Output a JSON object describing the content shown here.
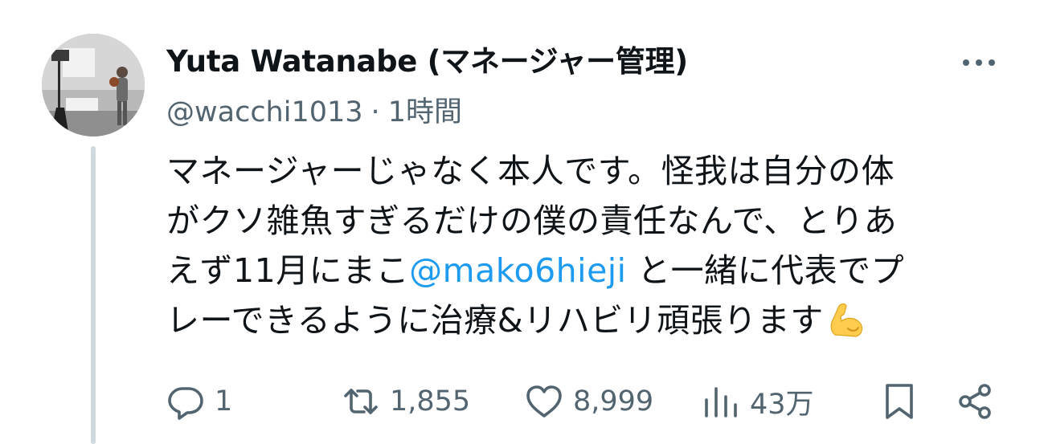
{
  "author": {
    "display_name": "Yuta Watanabe (マネージャー管理)",
    "handle": "@wacchi1013",
    "separator": "·",
    "timestamp": "1時間"
  },
  "tweet": {
    "line1": "マネージャーじゃなく本人です。怪我は自分の体",
    "line2": "がクソ雑魚すぎるだけの僕の責任なんで、とりあ",
    "line3_before": "えず11月にまこ",
    "line3_mention": "@mako6hieji",
    "line3_after": " と一緒に代表でプ",
    "line4": "レーできるように治療&リハビリ頑張ります",
    "emoji": "flexed-biceps-emoji"
  },
  "metrics": {
    "replies": "1",
    "retweets": "1,855",
    "likes": "8,999",
    "views": "43万"
  },
  "colors": {
    "text": "#0f1419",
    "secondary": "#536471",
    "link": "#1d9bf0",
    "thread_line": "#cfd9de"
  },
  "icons": {
    "more": "more-dots-icon",
    "reply": "reply-icon",
    "retweet": "retweet-icon",
    "like": "heart-icon",
    "views": "views-chart-icon",
    "bookmark": "bookmark-icon",
    "share": "share-icon"
  }
}
